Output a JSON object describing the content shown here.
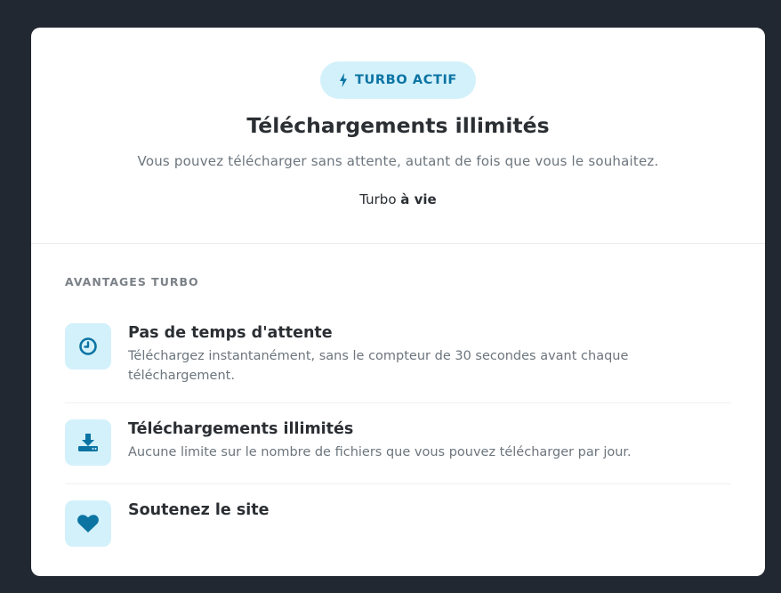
{
  "badge": {
    "label": "TURBO ACTIF",
    "icon": "lightning-icon"
  },
  "hero": {
    "title": "Téléchargements illimités",
    "subtitle": "Vous pouvez télécharger sans attente, autant de fois que vous le souhaitez.",
    "plan_prefix": "Turbo",
    "plan_duration": "à vie"
  },
  "benefits": {
    "heading": "AVANTAGES TURBO",
    "items": [
      {
        "icon": "clock-icon",
        "title": "Pas de temps d'attente",
        "description": "Téléchargez instantanément, sans le compteur de 30 secondes avant chaque téléchargement."
      },
      {
        "icon": "download-icon",
        "title": "Téléchargements illimités",
        "description": "Aucune limite sur le nombre de fichiers que vous pouvez télécharger par jour."
      },
      {
        "icon": "heart-icon",
        "title": "Soutenez le site",
        "description": ""
      }
    ]
  },
  "colors": {
    "page_background": "#222831",
    "card_background": "#ffffff",
    "accent": "#0b74a3",
    "accent_light": "#d3f1fb",
    "heading_text": "#2b2f33",
    "muted_text": "#6c757d"
  }
}
